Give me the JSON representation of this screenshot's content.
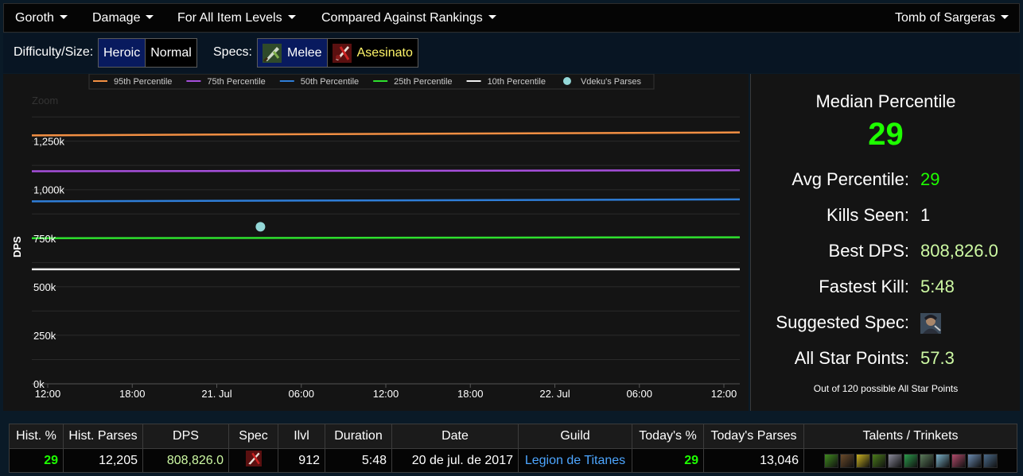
{
  "nav": {
    "boss": "Goroth",
    "metric": "Damage",
    "item_levels": "For All Item Levels",
    "compare": "Compared Against Rankings",
    "zone": "Tomb of Sargeras"
  },
  "filters": {
    "difficulty_label": "Difficulty/Size:",
    "difficulty_options": [
      "Heroic",
      "Normal"
    ],
    "difficulty_selected": "Heroic",
    "specs_label": "Specs:",
    "spec_options": [
      {
        "name": "Melee",
        "icon": "melee-spec-icon",
        "color": "#ffffff"
      },
      {
        "name": "Asesinato",
        "icon": "assassination-spec-icon",
        "color": "#fff569"
      }
    ]
  },
  "chart_data": {
    "type": "line",
    "title": "",
    "zoom_label": "Zoom",
    "ylabel": "DPS",
    "xlabel": "",
    "ylim": [
      0,
      1400000
    ],
    "y_ticks": [
      "0k",
      "250k",
      "500k",
      "750k",
      "1,000k",
      "1,250k"
    ],
    "y_tick_values": [
      0,
      250000,
      500000,
      750000,
      1000000,
      1250000
    ],
    "x_ticks": [
      "12:00",
      "18:00",
      "21. Jul",
      "06:00",
      "12:00",
      "18:00",
      "22. Jul",
      "06:00",
      "12:00"
    ],
    "x_range": [
      "2017-07-20 12:00",
      "2017-07-22 12:00"
    ],
    "grid": true,
    "legend_position": "top",
    "series": [
      {
        "name": "95th Percentile",
        "color": "#f28f43",
        "values": [
          1280000,
          1295000
        ]
      },
      {
        "name": "75th Percentile",
        "color": "#a64fdb",
        "values": [
          1095000,
          1100000
        ]
      },
      {
        "name": "50th Percentile",
        "color": "#2f7ed8",
        "values": [
          940000,
          950000
        ]
      },
      {
        "name": "25th Percentile",
        "color": "#2ee02e",
        "values": [
          750000,
          755000
        ]
      },
      {
        "name": "10th Percentile",
        "color": "#f0f0f0",
        "values": [
          590000,
          590000
        ]
      }
    ],
    "scatter": {
      "name": "Vdeku's Parses",
      "color": "#93d7d7",
      "points": [
        {
          "x": "2017-07-21 03:30",
          "y": 808826
        }
      ]
    }
  },
  "stats": {
    "median_title": "Median Percentile",
    "median_value": "29",
    "rows": [
      {
        "key": "Avg Percentile:",
        "value": "29",
        "color": "#1eff00"
      },
      {
        "key": "Kills Seen:",
        "value": "1",
        "color": "#ffffff"
      },
      {
        "key": "Best DPS:",
        "value": "808,826.0",
        "color": "#cdf9a3"
      },
      {
        "key": "Fastest Kill:",
        "value": "5:48",
        "color": "#cdf9a3"
      },
      {
        "key": "Suggested Spec:",
        "value": "",
        "icon": "assassination-rogue-portrait-icon"
      },
      {
        "key": "All Star Points:",
        "value": "57.3",
        "color": "#cdf9a3"
      }
    ],
    "footnote": "Out of 120 possible All Star Points"
  },
  "table": {
    "headers": [
      "Hist. %",
      "Hist. Parses",
      "DPS",
      "Spec",
      "Ilvl",
      "Duration",
      "Date",
      "Guild",
      "Today's %",
      "Today's Parses",
      "Talents / Trinkets"
    ],
    "rows": [
      {
        "hist_pct": "29",
        "hist_parses": "12,205",
        "dps": "808,826.0",
        "spec_icon": "assassination-spec-icon",
        "ilvl": "912",
        "duration": "5:48",
        "date": "20 de jul. de 2017",
        "guild": "Legion de Titanes",
        "today_pct": "29",
        "today_parses": "13,046",
        "talent_icons": [
          "talent-1-icon",
          "talent-2-icon",
          "talent-3-icon",
          "talent-4-icon",
          "talent-5-icon",
          "talent-6-icon",
          "talent-7-icon",
          "trinket-1-icon",
          "trinket-2-icon",
          "trinket-3-icon",
          "trinket-4-icon"
        ]
      }
    ]
  }
}
